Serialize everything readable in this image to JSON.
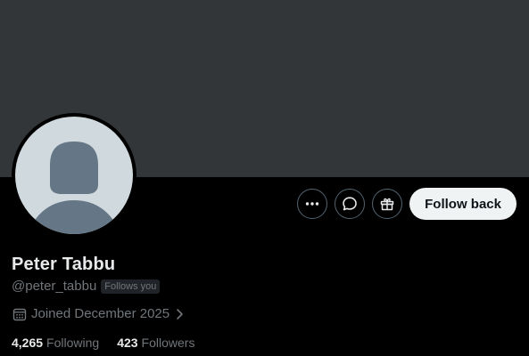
{
  "profile": {
    "name": "Peter Tabbu",
    "handle": "@peter_tabbu",
    "follows_you_badge": "Follows you",
    "joined": "Joined December 2025",
    "following_count": "4,265",
    "following_label": "Following",
    "followers_count": "423",
    "followers_label": "Followers"
  },
  "actions": {
    "follow_back_label": "Follow back",
    "more_icon": "more-icon",
    "message_icon": "message-icon",
    "gift_icon": "gift-icon"
  },
  "colors": {
    "background": "#000000",
    "banner": "#333639",
    "avatar_bg": "#cfd9de",
    "avatar_silhouette": "#657786",
    "muted_text": "#71767b",
    "primary_text": "#e7e9ea",
    "follow_button_bg": "#eff3f4"
  }
}
